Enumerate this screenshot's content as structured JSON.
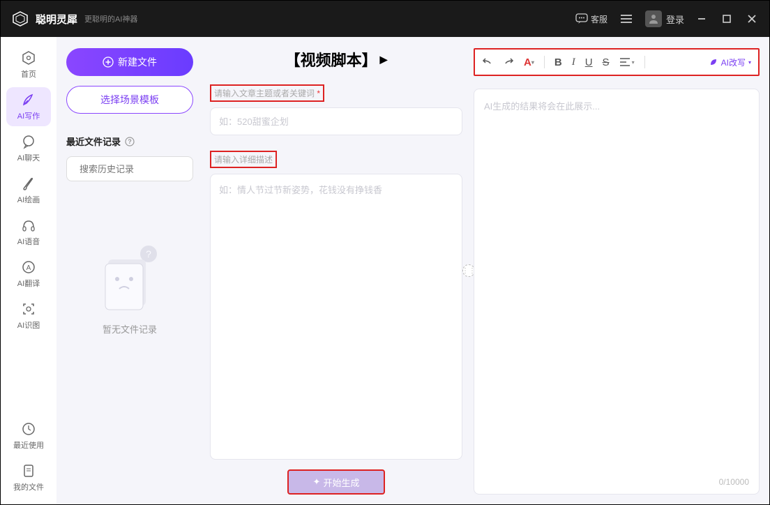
{
  "titlebar": {
    "app_name": "聪明灵犀",
    "app_sub": "更聪明的AI神器",
    "customer_service": "客服",
    "login": "登录"
  },
  "sidebar": {
    "items": [
      {
        "label": "首页"
      },
      {
        "label": "AI写作"
      },
      {
        "label": "AI聊天"
      },
      {
        "label": "AI绘画"
      },
      {
        "label": "AI语音"
      },
      {
        "label": "AI翻译"
      },
      {
        "label": "AI识图"
      },
      {
        "label": "最近使用"
      },
      {
        "label": "我的文件"
      }
    ]
  },
  "leftpanel": {
    "new_file": "新建文件",
    "choose_template": "选择场景模板",
    "recent_title": "最近文件记录",
    "search_placeholder": "搜索历史记录",
    "empty_text": "暂无文件记录"
  },
  "midpanel": {
    "title": "【视频脚本】",
    "field1_label": "请输入文章主题或者关键词",
    "field1_required": "*",
    "field1_placeholder": "如：520甜蜜企划",
    "field2_label": "请输入详细描述",
    "field2_placeholder": "如：情人节过节新姿势，花钱没有挣钱香",
    "generate_btn": "开始生成"
  },
  "rightpanel": {
    "ai_rewrite": "AI改写",
    "output_placeholder": "AI生成的结果将会在此展示...",
    "char_count": "0/10000"
  }
}
